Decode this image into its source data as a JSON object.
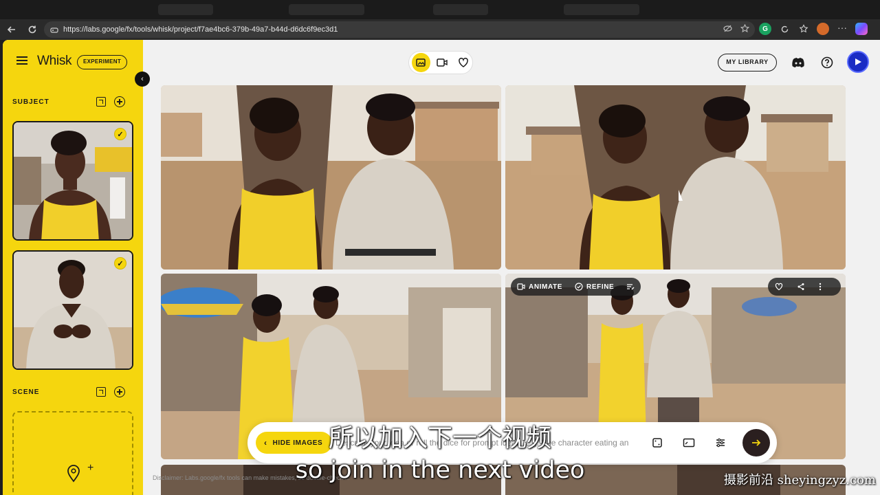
{
  "browser": {
    "url": "https://labs.google/fx/tools/whisk/project/f7ae4bc6-379b-49a7-b44d-d6dc6f9ec3d1",
    "extensions": [
      {
        "letter": "G",
        "color": "#1aa260"
      },
      {
        "letter": "",
        "color": "#d46a2a"
      }
    ]
  },
  "app": {
    "brand": "Whisk",
    "badge": "EXPERIMENT",
    "subject_title": "SUBJECT",
    "scene_title": "SCENE",
    "library_label": "MY LIBRARY",
    "accent": "#f5d60e"
  },
  "image_overlay": {
    "animate_label": "ANIMATE",
    "refine_label": "REFINE"
  },
  "prompt": {
    "hide_label": "HIDE IMAGES",
    "placeholder": "Describe your idea or roll the dice for prompt ideas (e.g. \"the character eating an ice cream\")"
  },
  "disclaimer": "Disclaimer: Labs.google/fx tools can make mistakes, so double-check it.",
  "subtitles": {
    "cn": "所以加入下一个视频",
    "en": "so join in the next video"
  },
  "watermark": "摄影前沿 sheyingzyz.com"
}
